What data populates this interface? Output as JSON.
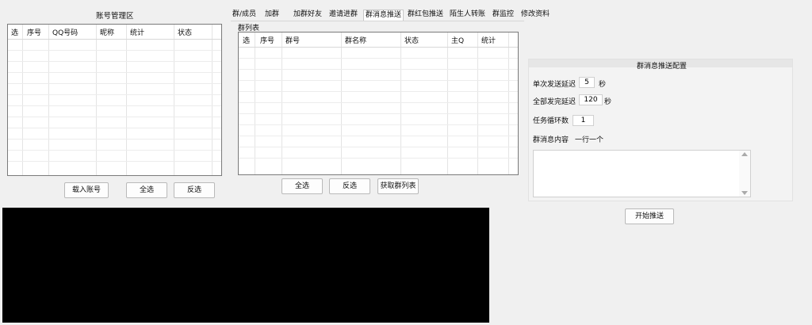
{
  "account_panel": {
    "title": "账号管理区",
    "columns": [
      "选",
      "序号",
      "QQ号码",
      "昵称",
      "统计",
      "状态"
    ],
    "load_button": "载入账号",
    "select_all_button": "全选",
    "invert_button": "反选"
  },
  "tabs": [
    {
      "label": "群/成员"
    },
    {
      "label": "加群"
    },
    {
      "label": "加群好友"
    },
    {
      "label": "邀请进群"
    },
    {
      "label": "群消息推送"
    },
    {
      "label": "群红包推送"
    },
    {
      "label": "陌生人转账"
    },
    {
      "label": "群监控"
    },
    {
      "label": "修改资料"
    }
  ],
  "group_list": {
    "title": "群列表",
    "columns": [
      "选",
      "序号",
      "群号",
      "群名称",
      "状态",
      "主Q",
      "统计"
    ],
    "select_all_button": "全选",
    "invert_button": "反选",
    "fetch_button": "获取群列表"
  },
  "push_config": {
    "title": "群消息推送配置",
    "single_delay_label": "单次发送延迟",
    "single_delay_value": "5",
    "single_delay_unit": "秒",
    "all_delay_label": "全部发完延迟",
    "all_delay_value": "120",
    "all_delay_unit": "秒",
    "loop_label": "任务循环数",
    "loop_value": "1",
    "content_label": "群消息内容",
    "content_hint": "一行一个",
    "content_value": "",
    "start_button": "开始推送"
  }
}
